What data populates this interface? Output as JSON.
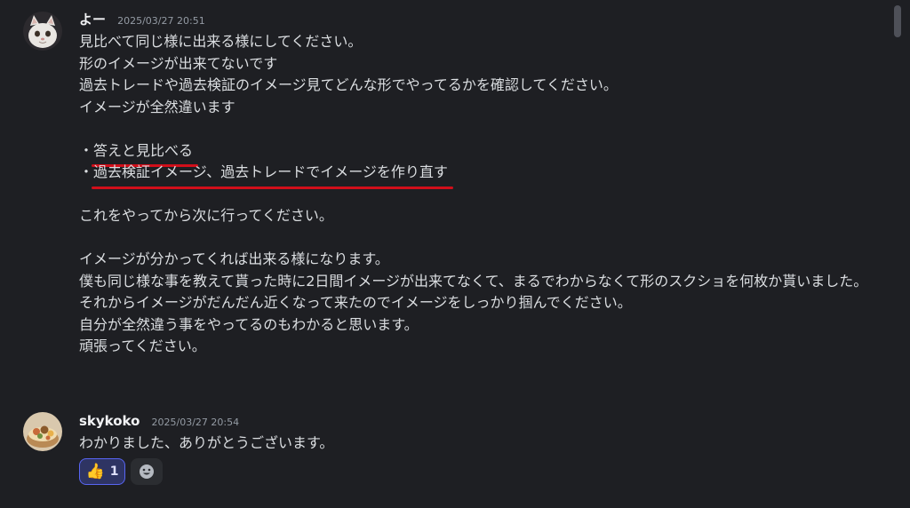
{
  "messages": [
    {
      "username": "よー",
      "timestamp": "2025/03/27 20:51",
      "avatar": "white-cat-avatar",
      "lines": {
        "l1": "見比べて同じ様に出来る様にしてください。",
        "l2": "形のイメージが出来てないです",
        "l3": "過去トレードや過去検証のイメージ見てどんな形でやってるかを確認してください。",
        "l4": "イメージが全然違います",
        "b1_bullet": "・",
        "b1_text": "答えと見比べる",
        "b2_bullet": "・",
        "b2_text": "過去検証イメージ、過去トレードでイメージを作り直す",
        "l5": "これをやってから次に行ってください。",
        "l6": "イメージが分かってくれば出来る様になります。",
        "l7": "僕も同じ様な事を教えて貰った時に2日間イメージが出来てなくて、まるでわからなくて形のスクショを何枚か貰いました。",
        "l8": "それからイメージがだんだん近くなって来たのでイメージをしっかり掴んでください。",
        "l9": "自分が全然違う事をやってるのもわかると思います。",
        "l10": "頑張ってください。"
      }
    },
    {
      "username": "skykoko",
      "timestamp": "2025/03/27 20:54",
      "avatar": "food-bowl-avatar",
      "text": "わかりました、ありがとうございます。",
      "reactions": [
        {
          "emoji": "👍",
          "count": "1"
        }
      ],
      "add_reaction_icon": "smiley-add-reaction-icon"
    }
  ],
  "colors": {
    "background": "#1e1f23",
    "underline": "#d10f1a",
    "reaction_bg": "#2e3463",
    "reaction_border": "#5865f2"
  }
}
